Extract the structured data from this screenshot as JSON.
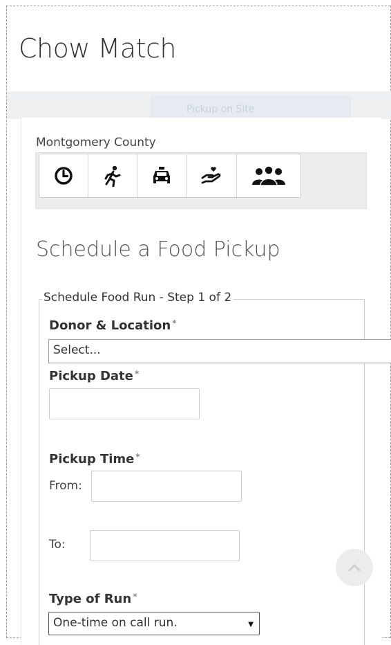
{
  "app": {
    "title": "Chow Match"
  },
  "band": {
    "ghost_text": "Pickup on Site"
  },
  "county": "Montgomery County",
  "toolbar": [
    {
      "icon": "clock-icon"
    },
    {
      "icon": "runner-icon"
    },
    {
      "icon": "car-icon"
    },
    {
      "icon": "giving-hand-heart-icon"
    },
    {
      "icon": "group-icon"
    }
  ],
  "section_title": "Schedule a Food Pickup",
  "form": {
    "legend": "Schedule Food Run - Step 1 of 2",
    "required_marker": "*",
    "donor": {
      "label": "Donor & Location",
      "value": "Select..."
    },
    "pickup_date": {
      "label": "Pickup Date",
      "value": ""
    },
    "pickup_time": {
      "label": "Pickup Time",
      "from_label": "From:",
      "to_label": "To:",
      "from_value": "",
      "to_value": ""
    },
    "type_of_run": {
      "label": "Type of Run",
      "value": "One-time on call run."
    }
  },
  "colors": {
    "band": "#eef0f2",
    "well": "#ececec",
    "text": "#333333"
  }
}
